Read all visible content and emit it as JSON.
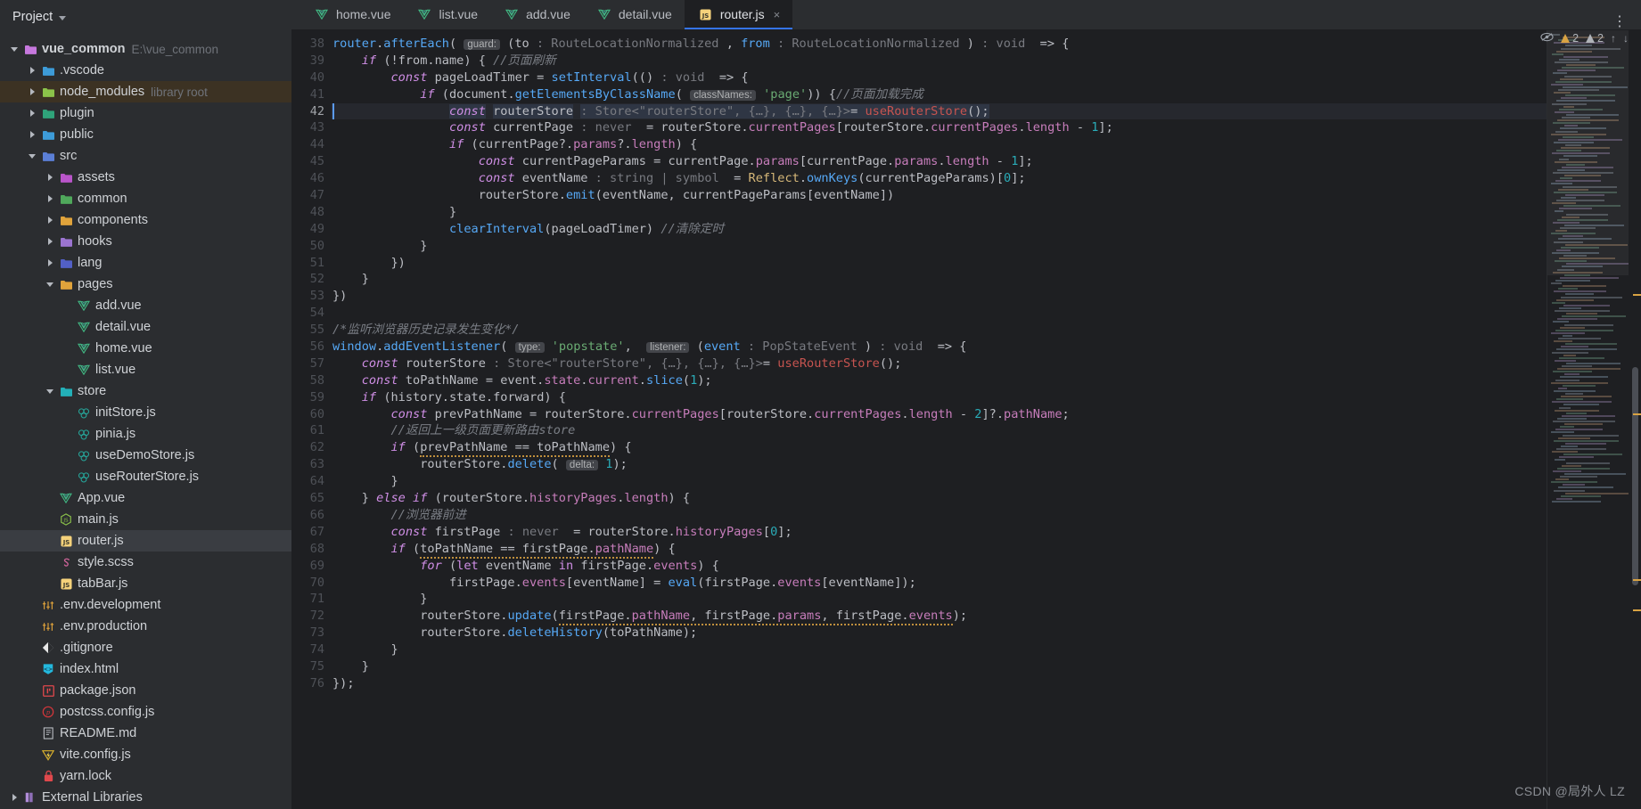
{
  "sidebar": {
    "title": "Project",
    "title_icon": "chevron-down-icon",
    "items": [
      {
        "label": "vue_common",
        "suffix": "E:\\vue_common",
        "icon": "folder-module-icon",
        "depth": 0,
        "state": "open",
        "bold": true
      },
      {
        "label": ".vscode",
        "suffix": "",
        "icon": "folder-vscode-icon",
        "depth": 1,
        "state": "closed"
      },
      {
        "label": "node_modules",
        "suffix": "library root",
        "icon": "folder-node-icon",
        "depth": 1,
        "state": "closed",
        "highlight": true
      },
      {
        "label": "plugin",
        "suffix": "",
        "icon": "folder-plugin-icon",
        "depth": 1,
        "state": "closed"
      },
      {
        "label": "public",
        "suffix": "",
        "icon": "folder-public-icon",
        "depth": 1,
        "state": "closed"
      },
      {
        "label": "src",
        "suffix": "",
        "icon": "folder-source-icon",
        "depth": 1,
        "state": "open"
      },
      {
        "label": "assets",
        "suffix": "",
        "icon": "folder-assets-icon",
        "depth": 2,
        "state": "closed"
      },
      {
        "label": "common",
        "suffix": "",
        "icon": "folder-common-icon",
        "depth": 2,
        "state": "closed"
      },
      {
        "label": "components",
        "suffix": "",
        "icon": "folder-components-icon",
        "depth": 2,
        "state": "closed"
      },
      {
        "label": "hooks",
        "suffix": "",
        "icon": "folder-hooks-icon",
        "depth": 2,
        "state": "closed"
      },
      {
        "label": "lang",
        "suffix": "",
        "icon": "folder-lang-icon",
        "depth": 2,
        "state": "closed"
      },
      {
        "label": "pages",
        "suffix": "",
        "icon": "folder-pages-icon",
        "depth": 2,
        "state": "open"
      },
      {
        "label": "add.vue",
        "suffix": "",
        "icon": "vue-file-icon",
        "depth": 3,
        "state": "leaf"
      },
      {
        "label": "detail.vue",
        "suffix": "",
        "icon": "vue-file-icon",
        "depth": 3,
        "state": "leaf"
      },
      {
        "label": "home.vue",
        "suffix": "",
        "icon": "vue-file-icon",
        "depth": 3,
        "state": "leaf"
      },
      {
        "label": "list.vue",
        "suffix": "",
        "icon": "vue-file-icon",
        "depth": 3,
        "state": "leaf"
      },
      {
        "label": "store",
        "suffix": "",
        "icon": "folder-store-icon",
        "depth": 2,
        "state": "open"
      },
      {
        "label": "initStore.js",
        "suffix": "",
        "icon": "pinia-file-icon",
        "depth": 3,
        "state": "leaf"
      },
      {
        "label": "pinia.js",
        "suffix": "",
        "icon": "pinia-file-icon",
        "depth": 3,
        "state": "leaf"
      },
      {
        "label": "useDemoStore.js",
        "suffix": "",
        "icon": "pinia-file-icon",
        "depth": 3,
        "state": "leaf"
      },
      {
        "label": "useRouterStore.js",
        "suffix": "",
        "icon": "pinia-file-icon",
        "depth": 3,
        "state": "leaf"
      },
      {
        "label": "App.vue",
        "suffix": "",
        "icon": "vue-file-icon",
        "depth": 2,
        "state": "leaf"
      },
      {
        "label": "main.js",
        "suffix": "",
        "icon": "nodejs-file-icon",
        "depth": 2,
        "state": "leaf"
      },
      {
        "label": "router.js",
        "suffix": "",
        "icon": "js-file-icon",
        "depth": 2,
        "state": "leaf",
        "selected": true
      },
      {
        "label": "style.scss",
        "suffix": "",
        "icon": "scss-file-icon",
        "depth": 2,
        "state": "leaf"
      },
      {
        "label": "tabBar.js",
        "suffix": "",
        "icon": "js-file-icon",
        "depth": 2,
        "state": "leaf"
      },
      {
        "label": ".env.development",
        "suffix": "",
        "icon": "env-file-icon",
        "depth": 1,
        "state": "leaf"
      },
      {
        "label": ".env.production",
        "suffix": "",
        "icon": "env-file-icon",
        "depth": 1,
        "state": "leaf"
      },
      {
        "label": ".gitignore",
        "suffix": "",
        "icon": "git-file-icon",
        "depth": 1,
        "state": "leaf"
      },
      {
        "label": "index.html",
        "suffix": "",
        "icon": "html-file-icon",
        "depth": 1,
        "state": "leaf"
      },
      {
        "label": "package.json",
        "suffix": "",
        "icon": "npm-file-icon",
        "depth": 1,
        "state": "leaf"
      },
      {
        "label": "postcss.config.js",
        "suffix": "",
        "icon": "postcss-file-icon",
        "depth": 1,
        "state": "leaf"
      },
      {
        "label": "README.md",
        "suffix": "",
        "icon": "markdown-file-icon",
        "depth": 1,
        "state": "leaf"
      },
      {
        "label": "vite.config.js",
        "suffix": "",
        "icon": "vite-file-icon",
        "depth": 1,
        "state": "leaf"
      },
      {
        "label": "yarn.lock",
        "suffix": "",
        "icon": "lock-file-icon",
        "depth": 1,
        "state": "leaf"
      },
      {
        "label": "External Libraries",
        "suffix": "",
        "icon": "libraries-icon",
        "depth": 0,
        "state": "closed"
      }
    ]
  },
  "tabs": [
    {
      "label": "home.vue",
      "icon": "vue-file-icon",
      "active": false,
      "closable": false
    },
    {
      "label": "list.vue",
      "icon": "vue-file-icon",
      "active": false,
      "closable": false
    },
    {
      "label": "add.vue",
      "icon": "vue-file-icon",
      "active": false,
      "closable": false
    },
    {
      "label": "detail.vue",
      "icon": "vue-file-icon",
      "active": false,
      "closable": false
    },
    {
      "label": "router.js",
      "icon": "js-file-icon",
      "active": true,
      "closable": true,
      "close_label": "×"
    }
  ],
  "tabbar": {
    "more_label": "⋮"
  },
  "inspections": {
    "eye_icon": "inspection-eye-icon",
    "warning_icon": "warning-triangle-icon",
    "warning_count": "2",
    "weak_warning_icon": "weak-warning-triangle-icon",
    "weak_warning_count": "2",
    "prev_label": "↑",
    "next_label": "↓"
  },
  "editor": {
    "first_line": 38,
    "current_line": 42,
    "lines": [
      {
        "n": 38,
        "html": "<span class=\"fn\">router</span><span class=\"id\">.</span><span class=\"fn\">afterEach</span><span class=\"id\">(</span> <span class=\"hintbox\">guard:</span> <span class=\"id\">(</span><span class=\"id\">to</span> <span class=\"hint\">: RouteLocationNormalized</span> <span class=\"id\">,</span> <span class=\"fn\">from</span> <span class=\"hint\">: RouteLocationNormalized</span> <span class=\"id\">)</span> <span class=\"hint\">: void</span>  <span class=\"id\">=&gt; {</span>"
      },
      {
        "n": 39,
        "html": "    <span class=\"kw\">if</span> <span class=\"id\">(!from.name) {</span> <span class=\"cmt\">//页面刷新</span>"
      },
      {
        "n": 40,
        "html": "        <span class=\"kw\">const</span> <span class=\"id\">pageLoadTimer = </span><span class=\"fn\">setInterval</span><span class=\"id\">(()</span> <span class=\"hint\">: void</span>  <span class=\"id\">=&gt; {</span>"
      },
      {
        "n": 41,
        "html": "            <span class=\"kw\">if</span> <span class=\"id\">(document.</span><span class=\"fn\">getElementsByClassName</span><span class=\"id\">(</span> <span class=\"hintbox\">classNames:</span> <span class=\"str\">'page'</span><span class=\"id\">)) {</span><span class=\"cmt\">//页面加载完成</span>"
      },
      {
        "n": 42,
        "html": "                <span class=\"kw\">const</span> <span class=\"id\">routerStore</span> <span class=\"hint\">: Store&lt;\"routerStore\", {…}, {…}, {…}&gt;</span><span class=\"id\">= </span><span class=\"red\">useRouterStore</span><span class=\"id\">();</span>"
      },
      {
        "n": 43,
        "html": "                <span class=\"kw\">const</span> <span class=\"id\">currentPage</span> <span class=\"hint\">: never</span>  <span class=\"id\">= routerStore.</span><span class=\"prop\">currentPages</span><span class=\"id\">[routerStore.</span><span class=\"prop\">currentPages</span><span class=\"id\">.</span><span class=\"prop\">length</span><span class=\"id\"> - </span><span class=\"num\">1</span><span class=\"id\">];</span>"
      },
      {
        "n": 44,
        "html": "                <span class=\"kw\">if</span> <span class=\"id\">(currentPage?.</span><span class=\"prop\">params</span><span class=\"id\">?.</span><span class=\"prop\">length</span><span class=\"id\">) {</span>"
      },
      {
        "n": 45,
        "html": "                    <span class=\"kw\">const</span> <span class=\"id\">currentPageParams = currentPage.</span><span class=\"prop\">params</span><span class=\"id\">[currentPage.</span><span class=\"prop\">params</span><span class=\"id\">.</span><span class=\"prop\">length</span><span class=\"id\"> - </span><span class=\"num\">1</span><span class=\"id\">];</span>"
      },
      {
        "n": 46,
        "html": "                    <span class=\"kw\">const</span> <span class=\"id\">eventName</span> <span class=\"hint\">: string | symbol</span>  <span class=\"id\">= </span><span class=\"kw2\" style=\"color:#d5b778;font-style:normal\">Reflect</span><span class=\"id\">.</span><span class=\"fn\">ownKeys</span><span class=\"id\">(currentPageParams)[</span><span class=\"num\">0</span><span class=\"id\">];</span>"
      },
      {
        "n": 47,
        "html": "                    <span class=\"id\">routerStore.</span><span class=\"fn\">emit</span><span class=\"id\">(eventName, currentPageParams[eventName])</span>"
      },
      {
        "n": 48,
        "html": "                <span class=\"id\">}</span>"
      },
      {
        "n": 49,
        "html": "                <span class=\"fn\">clearInterval</span><span class=\"id\">(pageLoadTimer)</span> <span class=\"cmt\">//清除定时</span>"
      },
      {
        "n": 50,
        "html": "            <span class=\"id\">}</span>"
      },
      {
        "n": 51,
        "html": "        <span class=\"id\">})</span>"
      },
      {
        "n": 52,
        "html": "    <span class=\"id\">}</span>"
      },
      {
        "n": 53,
        "html": "<span class=\"id\">})</span>"
      },
      {
        "n": 54,
        "html": ""
      },
      {
        "n": 55,
        "html": "<span class=\"cmt\">/*监听浏览器历史记录发生变化*/</span>"
      },
      {
        "n": 56,
        "html": "<span class=\"fn\">window</span><span class=\"id\">.</span><span class=\"fn\">addEventListener</span><span class=\"id\">(</span> <span class=\"hintbox\">type:</span> <span class=\"str\">'popstate'</span><span class=\"id\">,</span>  <span class=\"hintbox\">listener:</span> <span class=\"id\">(</span><span class=\"fn\">event</span> <span class=\"hint\">: PopStateEvent</span> <span class=\"id\">)</span> <span class=\"hint\">: void</span>  <span class=\"id\">=&gt; {</span>"
      },
      {
        "n": 57,
        "html": "    <span class=\"kw\">const</span> <span class=\"id\">routerStore</span> <span class=\"hint\">: Store&lt;\"routerStore\", {…}, {…}, {…}&gt;</span><span class=\"id\">= </span><span class=\"red\">useRouterStore</span><span class=\"id\">();</span>"
      },
      {
        "n": 58,
        "html": "    <span class=\"kw\">const</span> <span class=\"id\">toPathName = event.</span><span class=\"prop\">state</span><span class=\"id\">.</span><span class=\"prop\">current</span><span class=\"id\">.</span><span class=\"fn\">slice</span><span class=\"id\">(</span><span class=\"num\">1</span><span class=\"id\">);</span>"
      },
      {
        "n": 59,
        "html": "    <span class=\"kw\">if</span> <span class=\"id\">(history.</span><span class=\"id\">state.</span><span class=\"id\">forward) {</span>"
      },
      {
        "n": 60,
        "html": "        <span class=\"kw\">const</span> <span class=\"id\">prevPathName = routerStore.</span><span class=\"prop\">currentPages</span><span class=\"id\">[routerStore.</span><span class=\"prop\">currentPages</span><span class=\"id\">.</span><span class=\"prop\">length</span><span class=\"id\"> - </span><span class=\"num\">2</span><span class=\"id\">]?.</span><span class=\"prop\">pathName</span><span class=\"id\">;</span>"
      },
      {
        "n": 61,
        "html": "        <span class=\"cmt\">//返回上一级页面更新路由store</span>"
      },
      {
        "n": 62,
        "html": "        <span class=\"kw\">if</span> <span class=\"id\">(</span><span class=\"wavy\">prevPathName == toPathName</span><span class=\"id\">) {</span>"
      },
      {
        "n": 63,
        "html": "            <span class=\"id\">routerStore.</span><span class=\"fn\">delete</span><span class=\"id\">(</span> <span class=\"hintbox\">delta:</span> <span class=\"num\">1</span><span class=\"id\">);</span>"
      },
      {
        "n": 64,
        "html": "        <span class=\"id\">}</span>"
      },
      {
        "n": 65,
        "html": "    <span class=\"id\">} </span><span class=\"kw\">else if</span> <span class=\"id\">(routerStore.</span><span class=\"prop\">historyPages</span><span class=\"id\">.</span><span class=\"prop\">length</span><span class=\"id\">) {</span>"
      },
      {
        "n": 66,
        "html": "        <span class=\"cmt\">//浏览器前进</span>"
      },
      {
        "n": 67,
        "html": "        <span class=\"kw\">const</span> <span class=\"id\">firstPage</span> <span class=\"hint\">: never</span>  <span class=\"id\">= routerStore.</span><span class=\"prop\">historyPages</span><span class=\"id\">[</span><span class=\"num\">0</span><span class=\"id\">];</span>"
      },
      {
        "n": 68,
        "html": "        <span class=\"kw\">if</span> <span class=\"id\">(</span><span class=\"wavy\">toPathName == firstPage.<span class=\"prop\">pathName</span></span><span class=\"id\">) {</span>"
      },
      {
        "n": 69,
        "html": "            <span class=\"kw\">for</span> <span class=\"id\">(</span><span class=\"kw2\">let</span> <span class=\"id\">eventName</span> <span class=\"kw2\">in</span> <span class=\"id\">firstPage.</span><span class=\"prop\">events</span><span class=\"id\">) {</span>"
      },
      {
        "n": 70,
        "html": "                <span class=\"id\">firstPage.</span><span class=\"prop\">events</span><span class=\"id\">[eventName] = </span><span class=\"fn\">eval</span><span class=\"id\">(firstPage.</span><span class=\"prop\">events</span><span class=\"id\">[eventName]);</span>"
      },
      {
        "n": 71,
        "html": "            <span class=\"id\">}</span>"
      },
      {
        "n": 72,
        "html": "            <span class=\"id\">routerStore.</span><span class=\"fn\">update</span><span class=\"id\">(</span><span class=\"wavy\">firstPage.<span class=\"prop\">pathName</span>, firstPage.<span class=\"prop\">params</span>, firstPage.<span class=\"prop\">events</span></span><span class=\"id\">);</span>"
      },
      {
        "n": 73,
        "html": "            <span class=\"id\">routerStore.</span><span class=\"fn\">deleteHistory</span><span class=\"id\">(toPathName);</span>"
      },
      {
        "n": 74,
        "html": "        <span class=\"id\">}</span>"
      },
      {
        "n": 75,
        "html": "    <span class=\"id\">}</span>"
      },
      {
        "n": 76,
        "html": "<span class=\"id\">});</span>"
      }
    ]
  },
  "watermark": "CSDN @局外人 LZ"
}
